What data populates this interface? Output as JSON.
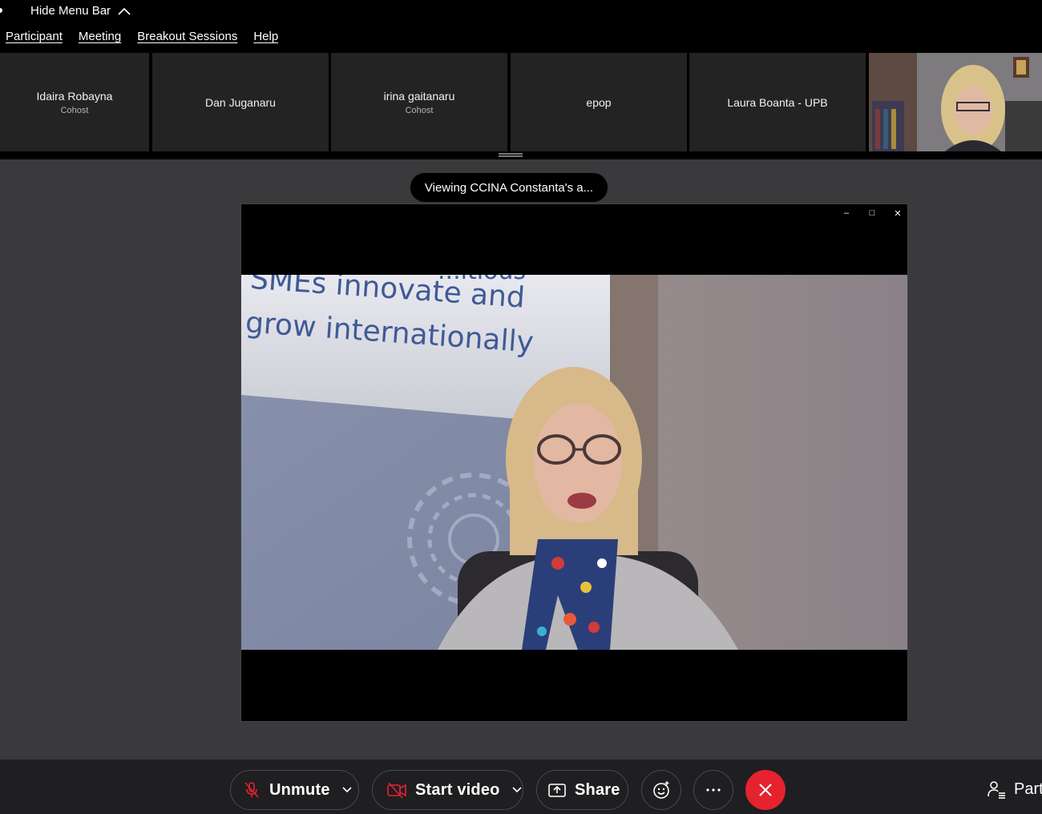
{
  "menu_bar_toggle": {
    "label": "Hide Menu Bar"
  },
  "menu": [
    "Participant",
    "Meeting",
    "Breakout Sessions",
    "Help"
  ],
  "participants": [
    {
      "name": "Idaira Robayna",
      "role": "Cohost"
    },
    {
      "name": "Dan Juganaru",
      "role": ""
    },
    {
      "name": "irina gaitanaru",
      "role": "Cohost"
    },
    {
      "name": "epop",
      "role": ""
    },
    {
      "name": "Laura Boanta - UPB",
      "role": ""
    }
  ],
  "viewing_banner": "Viewing CCINA Constanta's a...",
  "shared_content": {
    "banner_text_line1": "SMEs innovate and",
    "banner_text_line2": "grow internationally",
    "banner_partial": "...itious"
  },
  "toolbar": {
    "unmute": "Unmute",
    "start_video": "Start video",
    "share": "Share",
    "participants": "Part"
  },
  "colors": {
    "stage": "#3a393c",
    "toolbar": "#1f1e21",
    "end_call": "#e5232e",
    "tile": "#232323"
  }
}
